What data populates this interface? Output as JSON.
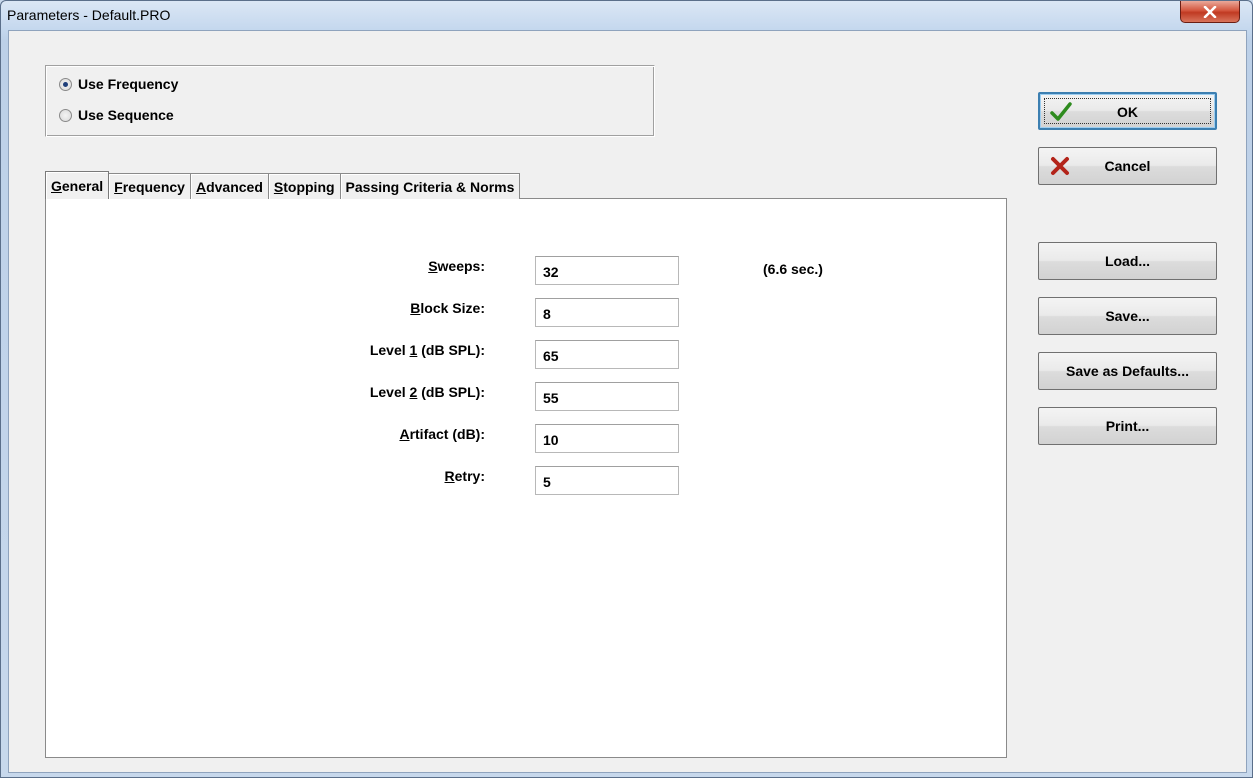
{
  "window": {
    "title": "Parameters - Default.PRO"
  },
  "mode": {
    "options": [
      {
        "label": "Use Frequency",
        "checked": true
      },
      {
        "label": "Use Sequence",
        "checked": false
      }
    ]
  },
  "tabs": [
    {
      "mnemonic": "G",
      "rest": "eneral",
      "active": true
    },
    {
      "mnemonic": "F",
      "rest": "requency",
      "active": false
    },
    {
      "mnemonic": "A",
      "rest": "dvanced",
      "active": false
    },
    {
      "mnemonic": "S",
      "rest": "topping",
      "active": false
    },
    {
      "mnemonic": "",
      "rest": "Passing Criteria & Norms",
      "active": false
    }
  ],
  "general": {
    "fields": [
      {
        "pre": "",
        "mnemonic": "S",
        "post": "weeps:",
        "value": "32"
      },
      {
        "pre": "",
        "mnemonic": "B",
        "post": "lock Size:",
        "value": "8"
      },
      {
        "pre": "Level ",
        "mnemonic": "1",
        "post": " (dB SPL):",
        "value": "65"
      },
      {
        "pre": "Level ",
        "mnemonic": "2",
        "post": " (dB SPL):",
        "value": "55"
      },
      {
        "pre": "",
        "mnemonic": "A",
        "post": "rtifact (dB):",
        "value": "10"
      },
      {
        "pre": "",
        "mnemonic": "R",
        "post": "etry:",
        "value": "5"
      }
    ],
    "duration": "(6.6 sec.)"
  },
  "buttons": {
    "ok": "OK",
    "cancel": "Cancel",
    "load": "Load...",
    "save": "Save...",
    "save_defaults": "Save as Defaults...",
    "print": "Print..."
  },
  "colors": {
    "ok_check": "#2e8b1e",
    "cancel_x": "#b3241a"
  },
  "icons": {
    "close": "close-icon",
    "ok": "checkmark-icon",
    "cancel": "x-mark-icon"
  }
}
